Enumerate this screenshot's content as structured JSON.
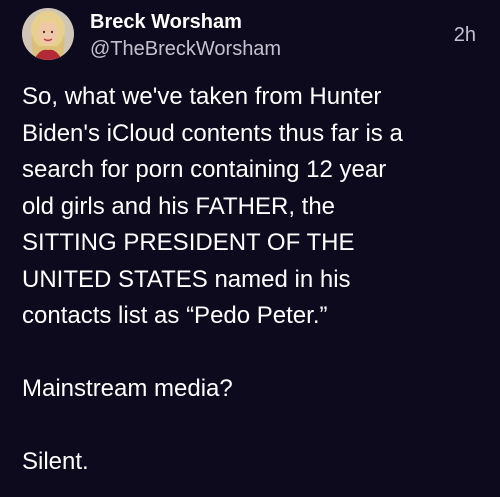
{
  "post": {
    "author": {
      "display_name": "Breck Worsham",
      "handle": "@TheBreckWorsham"
    },
    "timestamp": "2h",
    "body": {
      "paragraph_1_lines": [
        "So, what we've taken from Hunter",
        "Biden's iCloud contents thus far is a",
        "search for porn containing 12 year",
        "old girls and his FATHER, the",
        "SITTING PRESIDENT OF THE",
        "UNITED STATES named in his",
        "contacts list as “Pedo Peter.”"
      ],
      "paragraph_2": "Mainstream media?",
      "paragraph_3": "Silent."
    }
  },
  "colors": {
    "background": "#0c0a1c",
    "primary_text": "#ffffff",
    "secondary_text": "#c4c1cf"
  }
}
